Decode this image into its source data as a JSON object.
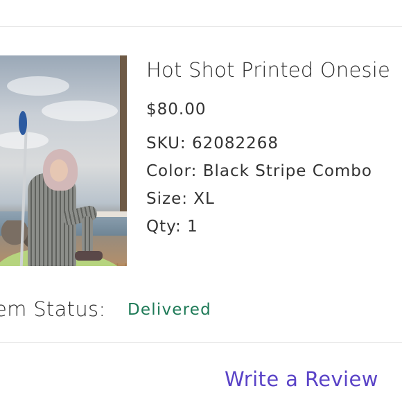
{
  "product": {
    "title": "Hot Shot Printed Onesie",
    "price": "$80.00",
    "sku": "SKU: 62082268",
    "color": "Color: Black Stripe Combo",
    "size": "Size: XL",
    "qty": "Qty: 1",
    "image_alt": "product-photo"
  },
  "status": {
    "label": "em Status:",
    "value": "Delivered",
    "value_color": "#1e7a57"
  },
  "actions": {
    "review_label": "Write a Review",
    "review_color": "#5a43c7"
  }
}
